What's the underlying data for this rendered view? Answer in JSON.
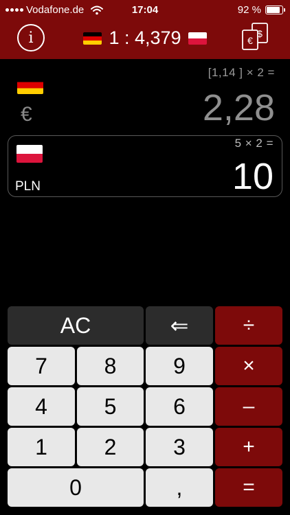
{
  "status_bar": {
    "carrier": "Vodafone.de",
    "time": "17:04",
    "battery_percent": "92 %",
    "battery_level": 0.92
  },
  "header": {
    "info_label": "i",
    "rate_text": "1 : 4,379",
    "from_flag": "germany-flag",
    "to_flag": "poland-flag",
    "exchange_icon": "euro-dollar-exchange-icon",
    "exchange_symbols": [
      "€",
      "$"
    ]
  },
  "source": {
    "currency_symbol": "€",
    "expression": "[1,14 ] × 2 =",
    "value": "2,28"
  },
  "target": {
    "currency_code": "PLN",
    "expression": "5 × 2 =",
    "value": "10"
  },
  "keypad": {
    "clear": "AC",
    "backspace": "⇐",
    "divide": "÷",
    "multiply": "×",
    "minus": "–",
    "plus": "+",
    "equals": "=",
    "decimal": ",",
    "digits": {
      "d0": "0",
      "d1": "1",
      "d2": "2",
      "d3": "3",
      "d4": "4",
      "d5": "5",
      "d6": "6",
      "d7": "7",
      "d8": "8",
      "d9": "9"
    }
  },
  "colors": {
    "accent": "#7d0a0a",
    "key_light": "#e8e8e8",
    "key_dark": "#2c2c2c",
    "background": "#000000"
  }
}
